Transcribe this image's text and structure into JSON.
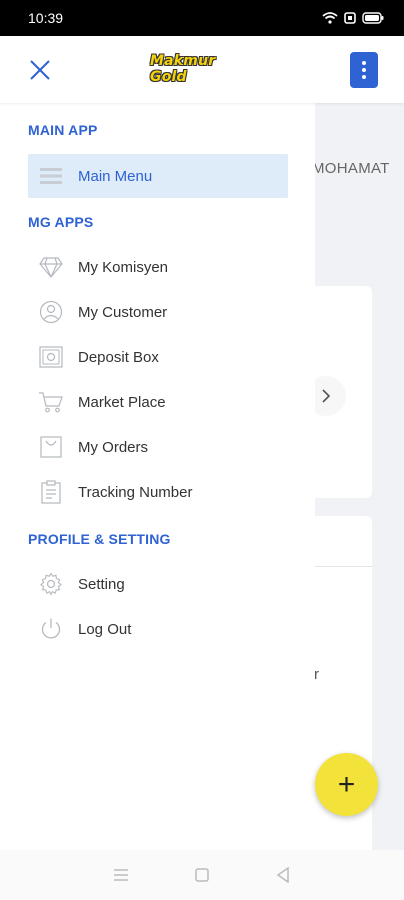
{
  "status_bar": {
    "time": "10:39"
  },
  "header": {
    "logo_text": "Makmur Gold"
  },
  "background": {
    "tab_text": "MOHAMAT",
    "partial_text": "r"
  },
  "drawer": {
    "sections": [
      {
        "title": "MAIN APP",
        "items": [
          {
            "label": "Main Menu",
            "icon": "menu-lines-icon",
            "active": true
          }
        ]
      },
      {
        "title": "MG APPS",
        "items": [
          {
            "label": "My Komisyen",
            "icon": "diamond-icon"
          },
          {
            "label": "My Customer",
            "icon": "user-circle-icon"
          },
          {
            "label": "Deposit Box",
            "icon": "safe-icon"
          },
          {
            "label": "Market Place",
            "icon": "cart-icon"
          },
          {
            "label": "My Orders",
            "icon": "bag-icon"
          },
          {
            "label": "Tracking Number",
            "icon": "clipboard-icon"
          }
        ]
      },
      {
        "title": "PROFILE & SETTING",
        "items": [
          {
            "label": "Setting",
            "icon": "gear-icon"
          },
          {
            "label": "Log Out",
            "icon": "power-icon"
          }
        ]
      }
    ]
  },
  "fab": {
    "label": "+"
  },
  "colors": {
    "accent": "#2f62d2",
    "active_bg": "#deebf9",
    "fab": "#f2e23a"
  }
}
